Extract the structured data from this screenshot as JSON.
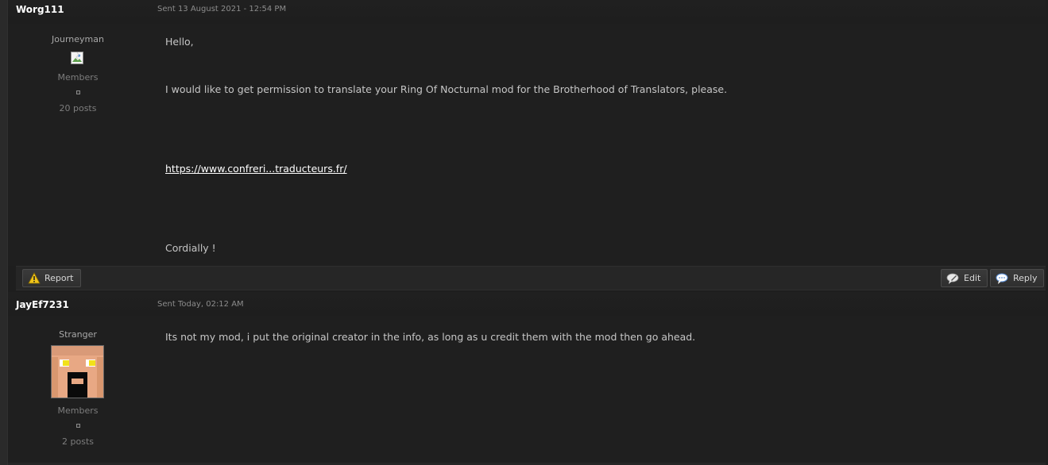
{
  "messages": [
    {
      "author": "Worg111",
      "sent": "Sent 13 August 2021 - 12:54 PM",
      "rank": "Journeyman",
      "group": "Members",
      "posts": "20 posts",
      "body": {
        "greeting": "Hello,",
        "request": "I would like to get permission to translate your Ring Of Nocturnal mod for the Brotherhood of Translators, please.",
        "link": "https://www.confreri...traducteurs.fr/",
        "closing": "Cordially !"
      }
    },
    {
      "author": "JayEf7231",
      "sent": "Sent Today, 02:12 AM",
      "rank": "Stranger",
      "group": "Members",
      "posts": "2 posts",
      "body": {
        "text": "Its not my mod, i put the original creator in the info, as long as u credit them with the mod then go ahead."
      }
    }
  ],
  "actions": {
    "report": "Report",
    "edit": "Edit",
    "reply": "Reply"
  },
  "icons": {
    "report": "warning-triangle-icon",
    "edit": "edit-bubble-icon",
    "reply": "reply-bubble-icon",
    "avatar1": "broken-image-icon",
    "avatar2": "pixel-face-avatar"
  },
  "colors": {
    "background": "#1e1e1e",
    "username": "#ffffff",
    "body_text": "#c6c6c6",
    "meta_text": "#8c8c8c",
    "warning": "#f0c419"
  }
}
